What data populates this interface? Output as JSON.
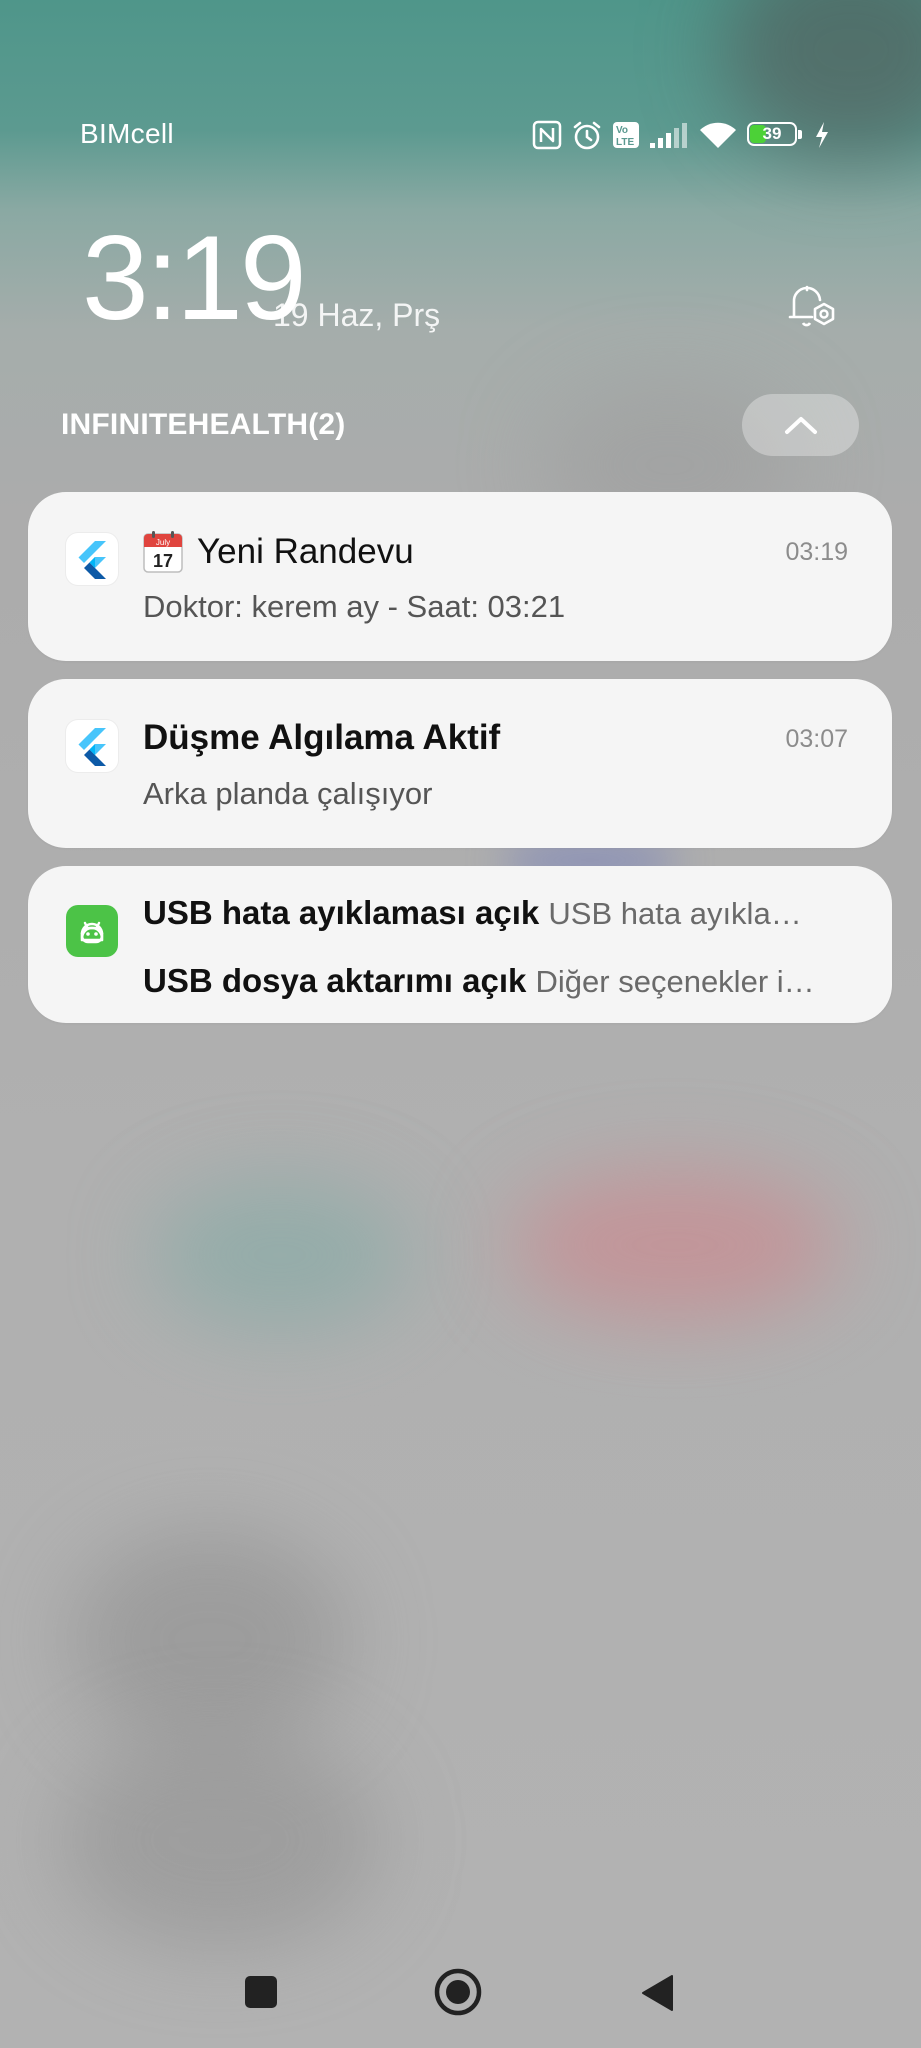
{
  "status_bar": {
    "carrier": "BIMcell",
    "battery_level": "39",
    "battery_fraction": 0.39,
    "battery_color": "#4cd137",
    "icons": [
      "nfc-icon",
      "alarm-icon",
      "volte-icon",
      "signal-icon",
      "wifi-icon",
      "battery-icon",
      "charging-icon"
    ]
  },
  "lockscreen": {
    "time": "3:19",
    "date": "19 Haz, Prş"
  },
  "notification_group": {
    "app_name": "INFINITEHEALTH(2)"
  },
  "notifications": [
    {
      "app_icon": "flutter-icon",
      "title_emoji_icon": "calendar-icon",
      "calendar_month": "July",
      "calendar_day": "17",
      "title": "Yeni Randevu",
      "text": "Doktor: kerem ay - Saat: 03:21",
      "time": "03:19"
    },
    {
      "app_icon": "flutter-icon",
      "title": "Düşme Algılama Aktif",
      "text": "Arka planda çalışıyor",
      "time": "03:07"
    }
  ],
  "system_notification": {
    "app_icon": "android-icon",
    "app_icon_color": "#4cc347",
    "rows": [
      {
        "title": "USB hata ayıklaması açık",
        "text": "USB hata ayıkla…"
      },
      {
        "title": "USB dosya aktarımı açık",
        "text": "Diğer seçenekler i…"
      }
    ]
  },
  "nav_bar": {
    "buttons": [
      "recents-button",
      "home-button",
      "back-button"
    ]
  }
}
